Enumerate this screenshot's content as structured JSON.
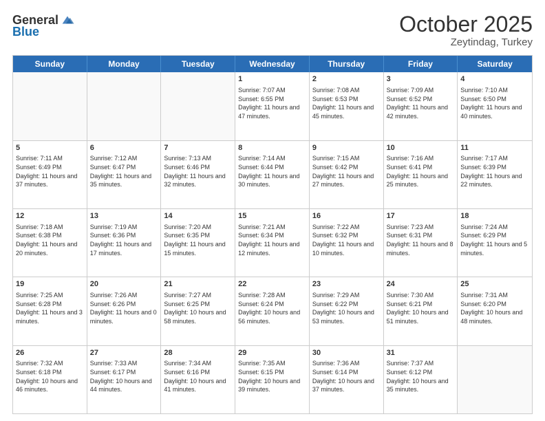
{
  "header": {
    "logo": {
      "general": "General",
      "blue": "Blue"
    },
    "title": "October 2025",
    "location": "Zeytindag, Turkey"
  },
  "weekdays": [
    "Sunday",
    "Monday",
    "Tuesday",
    "Wednesday",
    "Thursday",
    "Friday",
    "Saturday"
  ],
  "rows": [
    [
      {
        "day": "",
        "empty": true
      },
      {
        "day": "",
        "empty": true
      },
      {
        "day": "",
        "empty": true
      },
      {
        "day": "1",
        "info": "Sunrise: 7:07 AM\nSunset: 6:55 PM\nDaylight: 11 hours\nand 47 minutes."
      },
      {
        "day": "2",
        "info": "Sunrise: 7:08 AM\nSunset: 6:53 PM\nDaylight: 11 hours\nand 45 minutes."
      },
      {
        "day": "3",
        "info": "Sunrise: 7:09 AM\nSunset: 6:52 PM\nDaylight: 11 hours\nand 42 minutes."
      },
      {
        "day": "4",
        "info": "Sunrise: 7:10 AM\nSunset: 6:50 PM\nDaylight: 11 hours\nand 40 minutes."
      }
    ],
    [
      {
        "day": "5",
        "info": "Sunrise: 7:11 AM\nSunset: 6:49 PM\nDaylight: 11 hours\nand 37 minutes."
      },
      {
        "day": "6",
        "info": "Sunrise: 7:12 AM\nSunset: 6:47 PM\nDaylight: 11 hours\nand 35 minutes."
      },
      {
        "day": "7",
        "info": "Sunrise: 7:13 AM\nSunset: 6:46 PM\nDaylight: 11 hours\nand 32 minutes."
      },
      {
        "day": "8",
        "info": "Sunrise: 7:14 AM\nSunset: 6:44 PM\nDaylight: 11 hours\nand 30 minutes."
      },
      {
        "day": "9",
        "info": "Sunrise: 7:15 AM\nSunset: 6:42 PM\nDaylight: 11 hours\nand 27 minutes."
      },
      {
        "day": "10",
        "info": "Sunrise: 7:16 AM\nSunset: 6:41 PM\nDaylight: 11 hours\nand 25 minutes."
      },
      {
        "day": "11",
        "info": "Sunrise: 7:17 AM\nSunset: 6:39 PM\nDaylight: 11 hours\nand 22 minutes."
      }
    ],
    [
      {
        "day": "12",
        "info": "Sunrise: 7:18 AM\nSunset: 6:38 PM\nDaylight: 11 hours\nand 20 minutes."
      },
      {
        "day": "13",
        "info": "Sunrise: 7:19 AM\nSunset: 6:36 PM\nDaylight: 11 hours\nand 17 minutes."
      },
      {
        "day": "14",
        "info": "Sunrise: 7:20 AM\nSunset: 6:35 PM\nDaylight: 11 hours\nand 15 minutes."
      },
      {
        "day": "15",
        "info": "Sunrise: 7:21 AM\nSunset: 6:34 PM\nDaylight: 11 hours\nand 12 minutes."
      },
      {
        "day": "16",
        "info": "Sunrise: 7:22 AM\nSunset: 6:32 PM\nDaylight: 11 hours\nand 10 minutes."
      },
      {
        "day": "17",
        "info": "Sunrise: 7:23 AM\nSunset: 6:31 PM\nDaylight: 11 hours\nand 8 minutes."
      },
      {
        "day": "18",
        "info": "Sunrise: 7:24 AM\nSunset: 6:29 PM\nDaylight: 11 hours\nand 5 minutes."
      }
    ],
    [
      {
        "day": "19",
        "info": "Sunrise: 7:25 AM\nSunset: 6:28 PM\nDaylight: 11 hours\nand 3 minutes."
      },
      {
        "day": "20",
        "info": "Sunrise: 7:26 AM\nSunset: 6:26 PM\nDaylight: 11 hours\nand 0 minutes."
      },
      {
        "day": "21",
        "info": "Sunrise: 7:27 AM\nSunset: 6:25 PM\nDaylight: 10 hours\nand 58 minutes."
      },
      {
        "day": "22",
        "info": "Sunrise: 7:28 AM\nSunset: 6:24 PM\nDaylight: 10 hours\nand 56 minutes."
      },
      {
        "day": "23",
        "info": "Sunrise: 7:29 AM\nSunset: 6:22 PM\nDaylight: 10 hours\nand 53 minutes."
      },
      {
        "day": "24",
        "info": "Sunrise: 7:30 AM\nSunset: 6:21 PM\nDaylight: 10 hours\nand 51 minutes."
      },
      {
        "day": "25",
        "info": "Sunrise: 7:31 AM\nSunset: 6:20 PM\nDaylight: 10 hours\nand 48 minutes."
      }
    ],
    [
      {
        "day": "26",
        "info": "Sunrise: 7:32 AM\nSunset: 6:18 PM\nDaylight: 10 hours\nand 46 minutes."
      },
      {
        "day": "27",
        "info": "Sunrise: 7:33 AM\nSunset: 6:17 PM\nDaylight: 10 hours\nand 44 minutes."
      },
      {
        "day": "28",
        "info": "Sunrise: 7:34 AM\nSunset: 6:16 PM\nDaylight: 10 hours\nand 41 minutes."
      },
      {
        "day": "29",
        "info": "Sunrise: 7:35 AM\nSunset: 6:15 PM\nDaylight: 10 hours\nand 39 minutes."
      },
      {
        "day": "30",
        "info": "Sunrise: 7:36 AM\nSunset: 6:14 PM\nDaylight: 10 hours\nand 37 minutes."
      },
      {
        "day": "31",
        "info": "Sunrise: 7:37 AM\nSunset: 6:12 PM\nDaylight: 10 hours\nand 35 minutes."
      },
      {
        "day": "",
        "empty": true
      }
    ]
  ]
}
